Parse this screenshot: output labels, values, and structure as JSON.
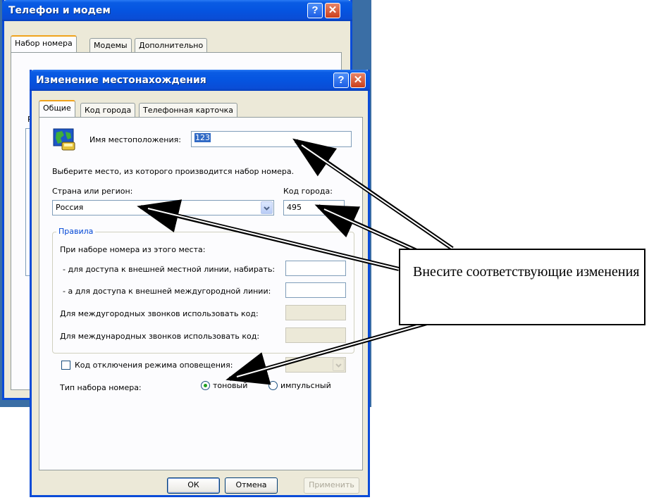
{
  "back_window": {
    "title": "Телефон и модем",
    "tabs": [
      "Набор номера",
      "Модемы",
      "Дополнительно"
    ],
    "partial_letter": "Р"
  },
  "dialog": {
    "title": "Изменение местонахождения",
    "tabs": [
      "Общие",
      "Код города",
      "Телефонная карточка"
    ],
    "location_name_label": "Имя местоположения:",
    "location_name_value": "123",
    "instruction": "Выберите место, из которого производится набор номера.",
    "country_label": "Страна или регион:",
    "country_value": "Россия",
    "area_code_label": "Код города:",
    "area_code_value": "495",
    "rules": {
      "title": "Правила",
      "intro": "При наборе номера из этого места:",
      "local_access_label": "- для доступа к внешней местной линии, набирать:",
      "local_access_value": "",
      "long_distance_access_label": "- а для доступа к внешней междугородной линии:",
      "long_distance_access_value": "",
      "long_distance_carrier_label": "Для междугородных звонков использовать код:",
      "international_carrier_label": "Для международных звонков использовать код:"
    },
    "call_waiting_label": "Код отключения режима оповещения:",
    "call_waiting_checked": false,
    "dial_type_label": "Тип набора номера:",
    "dial_tone": "тоновый",
    "dial_pulse": "импульсный",
    "dial_selected": "tone",
    "buttons": {
      "ok": "ОК",
      "cancel": "Отмена",
      "apply": "Применить"
    }
  },
  "callout": {
    "text": "Внесите соответствующие изменения"
  },
  "colors": {
    "title_blue": "#0554e0",
    "desktop": "#3a6ea5",
    "face": "#ece9d8",
    "accent_orange": "#f0a31c"
  }
}
